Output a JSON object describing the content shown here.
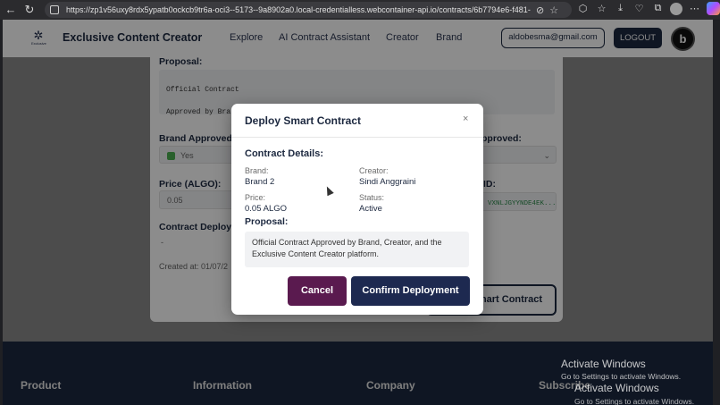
{
  "browser": {
    "url": "https://zp1v56uxy8rdx5ypatb0ockcb9tr6a-oci3--5173--9a8902a0.local-credentialless.webcontainer-api.io/contracts/6b7794e6-f481-..."
  },
  "header": {
    "logo_text": "Exclusive",
    "app_title": "Exclusive Content Creator",
    "nav": [
      "Explore",
      "AI Contract Assistant",
      "Creator",
      "Brand"
    ],
    "email": "aldobesma@gmail.com",
    "logout_label": "LOGOUT",
    "avatar_letter": "b"
  },
  "card": {
    "proposal_label": "Proposal:",
    "proposal_line1": "Official Contract",
    "proposal_line2": "Approved by Bra",
    "brand_approved_label": "Brand Approved",
    "brand_approved_value": "Yes",
    "creator_approved_label": "pproved:",
    "price_label": "Price (ALGO):",
    "price_value": "0.05",
    "id_label": "ID:",
    "id_value": "VXNLJGYYNDE4EK...",
    "deploy_label": "Contract Deploy",
    "deploy_value": "-",
    "created_at": "Created at: 01/07/2",
    "deploy_button": "mart Contract"
  },
  "modal": {
    "title": "Deploy Smart Contract",
    "close": "×",
    "details_title": "Contract Details:",
    "brand_key": "Brand:",
    "brand_value": "Brand 2",
    "creator_key": "Creator:",
    "creator_value": "Sindi Anggraini",
    "price_key": "Price:",
    "price_value": "0.05 ALGO",
    "status_key": "Status:",
    "status_value": "Active",
    "proposal_title": "Proposal:",
    "proposal_text": "Official Contract Approved by Brand, Creator, and the Exclusive Content Creator platform.",
    "cancel_label": "Cancel",
    "confirm_label": "Confirm Deployment"
  },
  "footer": {
    "headings": [
      "Product",
      "Information",
      "Company",
      "Subscribe"
    ]
  },
  "watermark": {
    "title": "Activate Windows",
    "subtitle": "Go to Settings to activate Windows.",
    "title2": "Activate Windows",
    "subtitle2": "Go to Settings to activate Windows."
  }
}
